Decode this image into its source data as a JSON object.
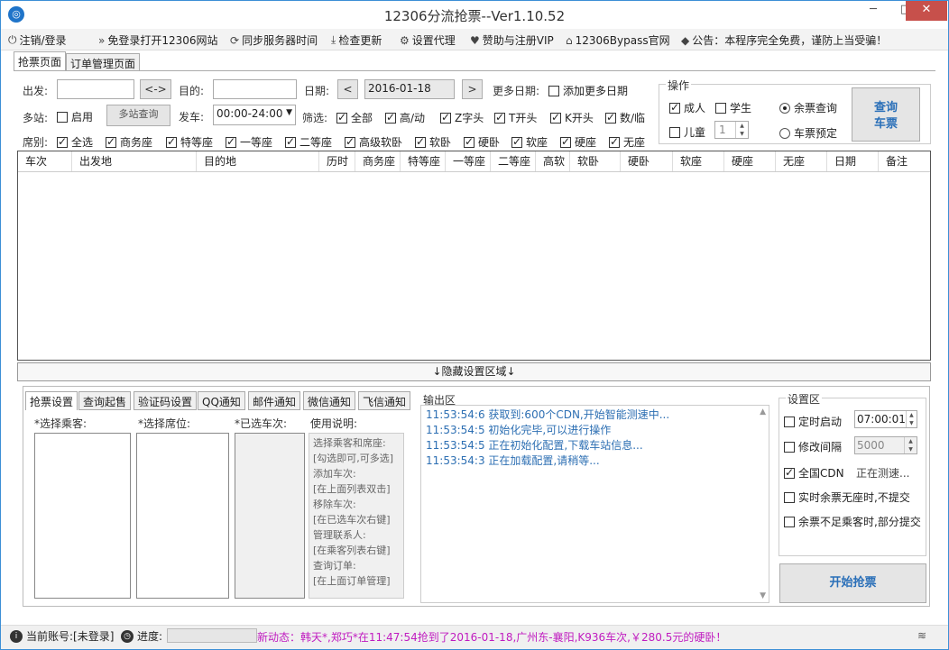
{
  "window": {
    "title": "12306分流抢票--Ver1.10.52",
    "minimize": "─",
    "maximize": "□",
    "close": "✕"
  },
  "menu": [
    {
      "icon": "power-icon",
      "glyph": "⏻",
      "label": "注销/登录"
    },
    {
      "icon": "double-chevron-icon",
      "glyph": "»",
      "label": "免登录打开12306网站"
    },
    {
      "icon": "sync-icon",
      "glyph": "⟳",
      "label": "同步服务器时间"
    },
    {
      "icon": "download-icon",
      "glyph": "⤓",
      "label": "检查更新"
    },
    {
      "icon": "gear-icon",
      "glyph": "⚙",
      "label": "设置代理"
    },
    {
      "icon": "heart-icon",
      "glyph": "♥",
      "label": "赞助与注册VIP"
    },
    {
      "icon": "home-icon",
      "glyph": "⌂",
      "label": "12306Bypass官网"
    },
    {
      "icon": "tag-icon",
      "glyph": "◆",
      "label": "公告：本程序完全免费，谨防上当受骗！"
    }
  ],
  "tabs": {
    "grab": "抢票页面",
    "orders": "订单管理页面"
  },
  "form": {
    "from_label": "出发:",
    "from_value": "",
    "swap": "<->",
    "to_label": "目的:",
    "to_value": "",
    "date_label": "日期:",
    "date_prev": "<",
    "date_value": "2016-01-18",
    "date_next": ">",
    "more_dates_label": "更多日期:",
    "add_more_dates": "添加更多日期",
    "multi_label": "多站:",
    "enable": "启用",
    "multi_query": "多站查询",
    "depart_label": "发车:",
    "depart_value": "00:00-24:00",
    "filter_label": "筛选:",
    "filters": [
      {
        "label": "全部",
        "checked": true
      },
      {
        "label": "高/动",
        "checked": true
      },
      {
        "label": "Z字头",
        "checked": true
      },
      {
        "label": "T开头",
        "checked": true
      },
      {
        "label": "K开头",
        "checked": true
      },
      {
        "label": "数/临",
        "checked": true
      }
    ],
    "seat_label": "席别:",
    "seats": [
      {
        "label": "全选",
        "checked": true
      },
      {
        "label": "商务座",
        "checked": true
      },
      {
        "label": "特等座",
        "checked": true
      },
      {
        "label": "一等座",
        "checked": true
      },
      {
        "label": "二等座",
        "checked": true
      },
      {
        "label": "高级软卧",
        "checked": true
      },
      {
        "label": "软卧",
        "checked": true
      },
      {
        "label": "硬卧",
        "checked": true
      },
      {
        "label": "软座",
        "checked": true
      },
      {
        "label": "硬座",
        "checked": true
      },
      {
        "label": "无座",
        "checked": true
      }
    ]
  },
  "ops": {
    "title": "操作",
    "adult": "成人",
    "adult_checked": true,
    "student": "学生",
    "student_checked": false,
    "child": "儿童",
    "child_checked": false,
    "child_count": "1",
    "remain_query": "余票查询",
    "remain_selected": true,
    "reserve": "车票预定",
    "reserve_selected": false,
    "query_button_l1": "查询",
    "query_button_l2": "车票"
  },
  "table": {
    "columns": [
      "车次",
      "出发地",
      "目的地",
      "历时",
      "商务座",
      "特等座",
      "一等座",
      "二等座",
      "高软",
      "软卧",
      "硬卧",
      "软座",
      "硬座",
      "无座",
      "日期",
      "备注"
    ]
  },
  "hide_settings": "↓隐藏设置区域↓",
  "subtabs": [
    "抢票设置",
    "查询起售",
    "验证码设置",
    "QQ通知",
    "邮件通知",
    "微信通知",
    "飞信通知"
  ],
  "grab": {
    "passengers_label": "*选择乘客:",
    "seats_label": "*选择席位:",
    "trains_label": "*已选车次:",
    "help_label": "使用说明:",
    "help_lines": [
      "选择乘客和席座:",
      "[勾选即可,可多选]",
      "添加车次:",
      "[在上面列表双击]",
      "移除车次:",
      "[在已选车次右键]",
      "管理联系人:",
      "[在乘客列表右键]",
      "查询订单:",
      "[在上面订单管理]"
    ]
  },
  "output": {
    "title": "输出区",
    "lines": [
      "11:53:54:6  获取到:600个CDN,开始智能测速中...",
      "11:53:54:5  初始化完毕,可以进行操作",
      "11:53:54:5  正在初始化配置,下载车站信息...",
      "11:53:54:3  正在加载配置,请稍等..."
    ]
  },
  "settings": {
    "title": "设置区",
    "timer_label": "定时启动",
    "timer_checked": false,
    "timer_value": "07:00:01",
    "interval_label": "修改间隔",
    "interval_checked": false,
    "interval_value": "5000",
    "cdn_label": "全国CDN",
    "cdn_checked": true,
    "cdn_status": "正在测速...",
    "no_seat_label": "实时余票无座时,不提交",
    "no_seat_checked": false,
    "partial_label": "余票不足乘客时,部分提交",
    "partial_checked": false,
    "start_button": "开始抢票"
  },
  "status": {
    "account": "当前账号:[未登录]",
    "progress_label": "进度:",
    "progress_fraction": 0,
    "news": "新动态：韩天*,郑巧*在11:47:54抢到了2016-01-18,广州东-襄阳,K936车次,￥280.5元的硬卧！"
  }
}
